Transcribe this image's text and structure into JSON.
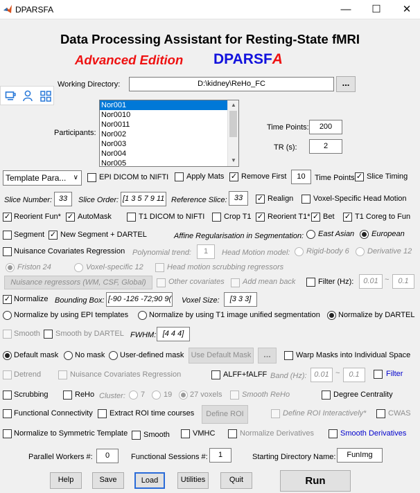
{
  "window": {
    "title": "DPARSFA",
    "minimize": "—",
    "maximize": "☐",
    "close": "✕"
  },
  "header": {
    "title": "Data Processing Assistant for Resting-State fMRI",
    "edition": "Advanced Edition",
    "logo_main": "DPARSF",
    "logo_suffix": "A",
    "edition_color": "#ee1111",
    "logo_color": "#1111dd"
  },
  "toolbar_icons": [
    "coffee-icon",
    "user-icon",
    "grid-icon"
  ],
  "working_directory": {
    "label": "Working Directory:",
    "value": "D:\\kidney\\ReHo_FC",
    "browse": "..."
  },
  "participants": {
    "label": "Participants:",
    "items": [
      "Nor001",
      "Nor0010",
      "Nor0011",
      "Nor002",
      "Nor003",
      "Nor004",
      "Nor005"
    ],
    "selected_index": 0
  },
  "time_points": {
    "label": "Time Points:",
    "value": "200"
  },
  "tr": {
    "label": "TR (s):",
    "value": "2"
  },
  "template": {
    "value": "Template Para...",
    "arrow": "∨"
  },
  "row1": {
    "epi_dicom": "EPI DICOM to NIFTI",
    "apply_mats": "Apply Mats",
    "remove_first": "Remove First",
    "remove_first_value": "10",
    "time_points": "Time Points",
    "slice_timing": "Slice Timing"
  },
  "row2": {
    "slice_number_label": "Slice Number:",
    "slice_number": "33",
    "slice_order_label": "Slice Order:",
    "slice_order": "[1 3 5 7 9 11",
    "reference_slice_label": "Reference Slice:",
    "reference_slice": "33",
    "realign": "Realign",
    "voxel_specific_head_motion": "Voxel-Specific Head Motion"
  },
  "row3": {
    "reorient_fun": "Reorient Fun*",
    "automask": "AutoMask",
    "t1_dicom": "T1 DICOM to NIFTI",
    "crop_t1": "Crop T1",
    "reorient_t1": "Reorient T1*",
    "bet": "Bet",
    "t1_coreg": "T1 Coreg to Fun"
  },
  "row4": {
    "segment": "Segment",
    "new_segment": "New Segment + DARTEL",
    "affine_label": "Affine Regularisation in Segmentation:",
    "east_asian": "East Asian",
    "european": "European"
  },
  "nuisance": {
    "label": "Nuisance Covariates Regression",
    "poly_label": "Polynomial trend:",
    "poly_value": "1",
    "head_motion_model": "Head Motion model:",
    "rigid_body": "Rigid-body 6",
    "derivative": "Derivative 12",
    "friston": "Friston 24",
    "voxel_specific": "Voxel-specific 12",
    "scrubbing_regressors": "Head motion scrubbing regressors",
    "regressors_button": "Nuisance regressors (WM, CSF, Global)",
    "other_covariates": "Other covariates",
    "add_mean_back": "Add mean back",
    "filter_label": "Filter (Hz):",
    "filter_low": "0.01",
    "filter_tilde": "~",
    "filter_high": "0.1"
  },
  "normalize": {
    "label": "Normalize",
    "bbox_label": "Bounding Box:",
    "bbox_value": "[-90 -126 -72;90 9(",
    "voxel_label": "Voxel Size:",
    "voxel_value": "[3 3 3]",
    "by_epi": "Normalize by using EPI templates",
    "by_t1": "Normalize by using T1 image unified segmentation",
    "by_dartel": "Normalize by DARTEL"
  },
  "smooth": {
    "smooth": "Smooth",
    "smooth_dartel": "Smooth by DARTEL",
    "fwhm_label": "FWHM:",
    "fwhm_value": "[4 4 4]"
  },
  "mask": {
    "default": "Default mask",
    "none": "No mask",
    "user_defined": "User-defined mask",
    "use_default_button": "Use Default Mask",
    "browse": "...",
    "warp": "Warp Masks into Individual Space"
  },
  "detrend_row": {
    "detrend": "Detrend",
    "nuisance": "Nuisance Covariates Regression",
    "alff": "ALFF+fALFF",
    "band_label": "Band (Hz):",
    "band_low": "0.01",
    "band_tilde": "~",
    "band_high": "0.1",
    "filter": "Filter"
  },
  "scrub_row": {
    "scrubbing": "Scrubbing",
    "reho": "ReHo",
    "cluster_label": "Cluster:",
    "c7": "7",
    "c19": "19",
    "c27": "27 voxels",
    "smooth_reho": "Smooth ReHo",
    "degree": "Degree Centrality"
  },
  "fc_row": {
    "fc": "Functional Connectivity",
    "extract_roi": "Extract ROI time courses",
    "define_roi": "Define ROI",
    "define_interactively": "Define ROI Interactively*",
    "cwas": "CWAS"
  },
  "sym_row": {
    "normalize_sym": "Normalize to Symmetric Template",
    "smooth": "Smooth",
    "vmhc": "VMHC",
    "normalize_deriv": "Normalize Derivatives",
    "smooth_deriv": "Smooth Derivatives"
  },
  "bottom": {
    "workers_label": "Parallel Workers #:",
    "workers_value": "0",
    "sessions_label": "Functional Sessions #:",
    "sessions_value": "1",
    "startdir_label": "Starting Directory Name:",
    "startdir_value": "FunImg"
  },
  "buttons": {
    "help": "Help",
    "save": "Save",
    "load": "Load",
    "utilities": "Utilities",
    "quit": "Quit",
    "run": "Run"
  },
  "check_mark": "✓",
  "scroll_up": "▲",
  "scroll_down": "▼"
}
